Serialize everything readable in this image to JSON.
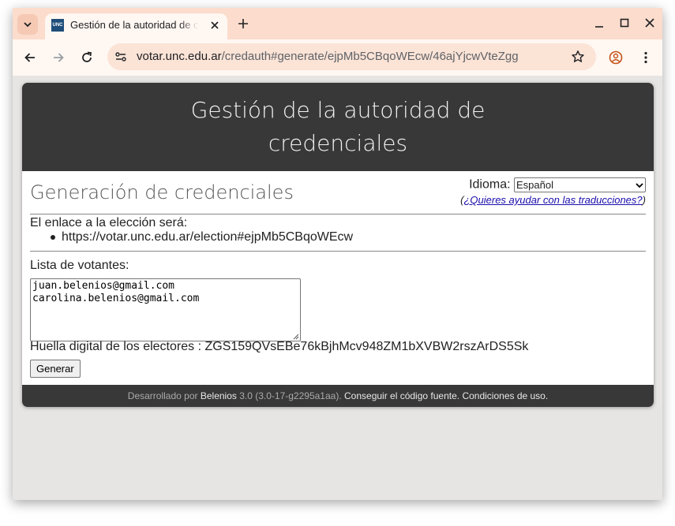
{
  "browser": {
    "tab_title": "Gestión de la autoridad de credenciales",
    "favicon_text": "UNC",
    "url_host": "votar.unc.edu.ar",
    "url_path": "/credauth#generate/ejpMb5CBqoWEcw/46ajYjcwVteZgg"
  },
  "page": {
    "banner_title": "Gestión de la autoridad de credenciales",
    "subtitle": "Generación de credenciales",
    "language_label": "Idioma:",
    "language_selected": "Español",
    "translate_prefix": "(",
    "translate_link": "¿Quieres ayudar con las traducciones?",
    "translate_suffix": ")",
    "election_link_label": "El enlace a la elección será:",
    "election_link": "https://votar.unc.edu.ar/election#ejpMb5CBqoWEcw",
    "voters_label": "Lista de votantes:",
    "voters": [
      "juan.belenios@gmail.com",
      "carolina.belenios@gmail.com"
    ],
    "fingerprint_label": "Huella digital de los electores :",
    "fingerprint": "ZGS159QVsEBe76kBjhMcv948ZM1bXVBW2rszArDS5Sk",
    "generate_button": "Generar"
  },
  "footer": {
    "developed_by": "Desarrollado por",
    "belenios": "Belenios",
    "version": "3.0 (3.0-17-g2295a1aa).",
    "source_link": "Conseguir el código fuente.",
    "terms_link": "Condiciones de uso."
  },
  "colors": {
    "tabstrip": "#fcdccc",
    "banner": "#383838",
    "link": "#1a0dab"
  }
}
